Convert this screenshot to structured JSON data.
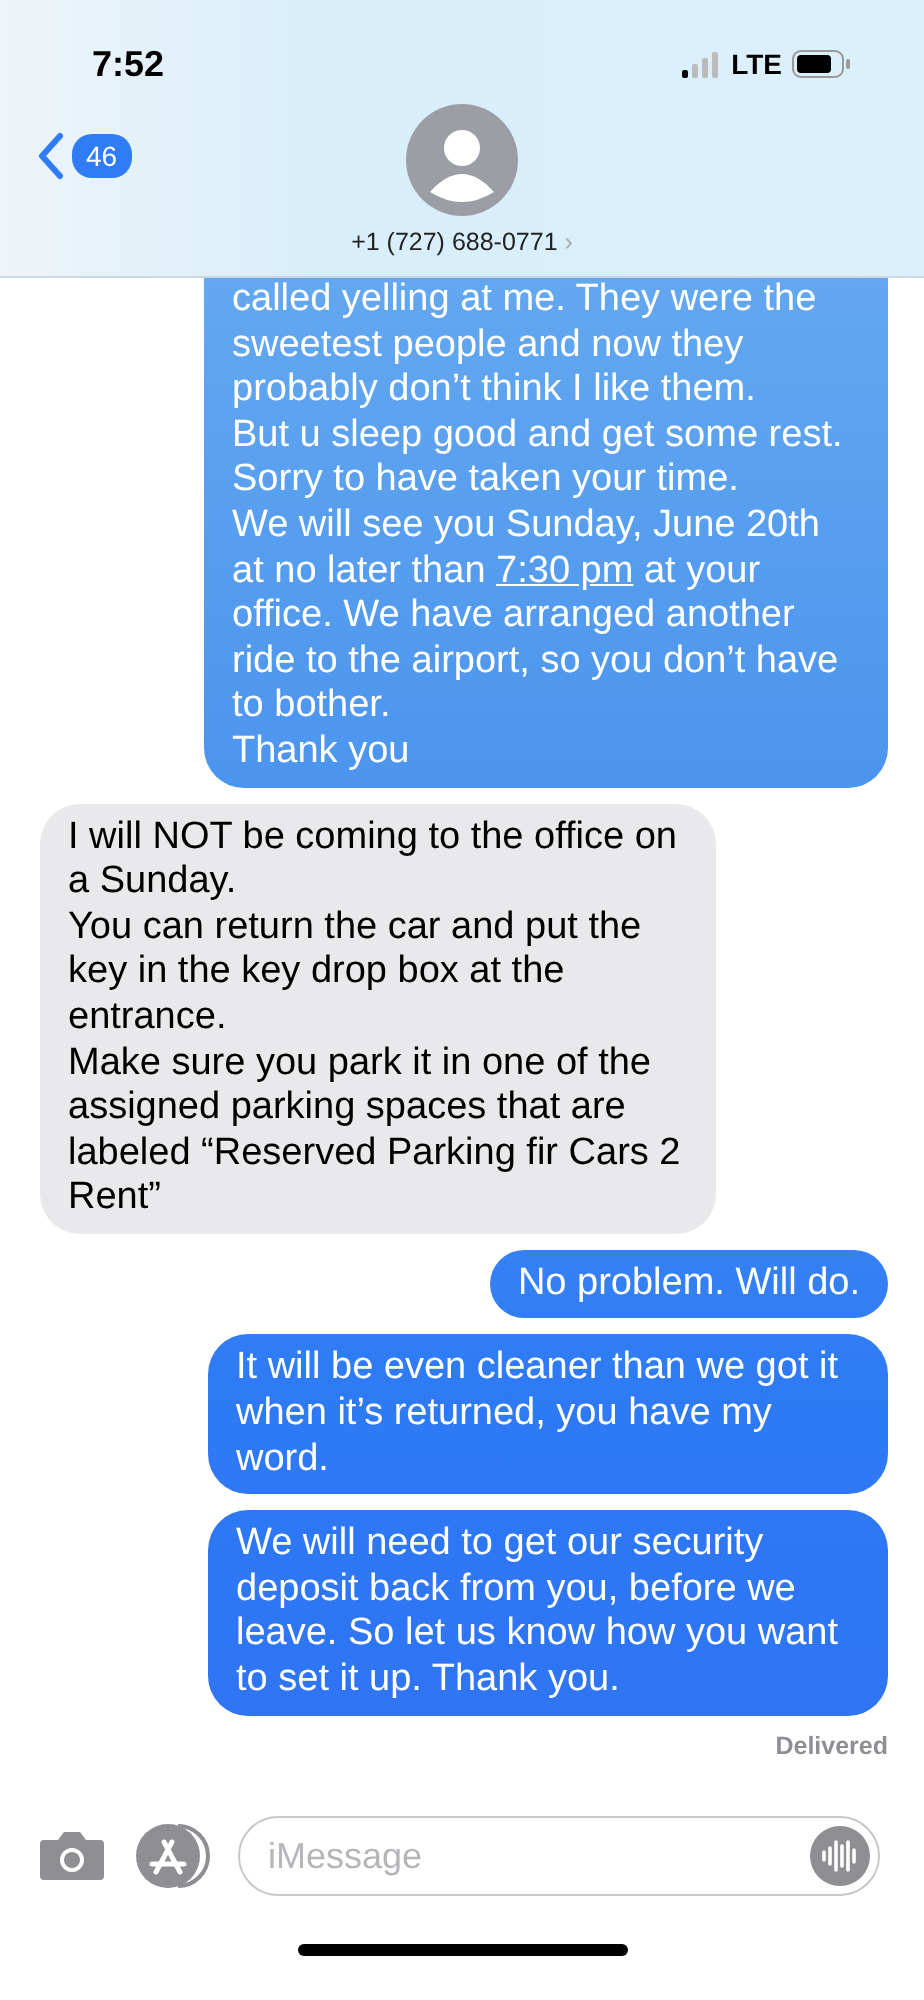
{
  "status_bar": {
    "time": "7:52",
    "network": "LTE"
  },
  "header": {
    "unread_count": "46",
    "contact": "+1 (727) 688-0771",
    "chevron": "›"
  },
  "messages": [
    {
      "kind": "sent",
      "paragraphs": [
        [
          {
            "text": "called yelling at me. They were the sweetest people and now they probably don’t think I like them."
          }
        ],
        [
          {
            "text": "But u sleep good and get some rest."
          }
        ],
        [
          {
            "text": "Sorry to have taken your time."
          }
        ],
        [
          {
            "text": "We will see you Sunday, June 20th at no later than "
          },
          {
            "text": "7:30 pm",
            "kind": "link"
          },
          {
            "text": " at your office. We have arranged another ride to the airport, so you don’t have to bother."
          }
        ],
        [
          {
            "text": "Thank you"
          }
        ]
      ]
    },
    {
      "kind": "received",
      "paragraphs": [
        [
          {
            "text": "I will NOT be coming to the office on a Sunday."
          }
        ],
        [
          {
            "text": "You can return the car and put the key in the key drop box at the entrance."
          }
        ],
        [
          {
            "text": "Make sure you park it in one of the assigned parking spaces that are labeled “Reserved Parking fir Cars 2 Rent”"
          }
        ]
      ]
    },
    {
      "kind": "sent",
      "paragraphs": [
        [
          {
            "text": "No problem. Will do."
          }
        ]
      ]
    },
    {
      "kind": "sent",
      "paragraphs": [
        [
          {
            "text": "It will be even cleaner than we got it when it’s returned, you have my word."
          }
        ]
      ]
    },
    {
      "kind": "sent",
      "paragraphs": [
        [
          {
            "text": "We will need to get our security deposit back from you, before we leave. So let us know how you want to set it up. Thank you."
          }
        ]
      ]
    }
  ],
  "delivery_status": "Delivered",
  "composer": {
    "placeholder": "iMessage"
  }
}
